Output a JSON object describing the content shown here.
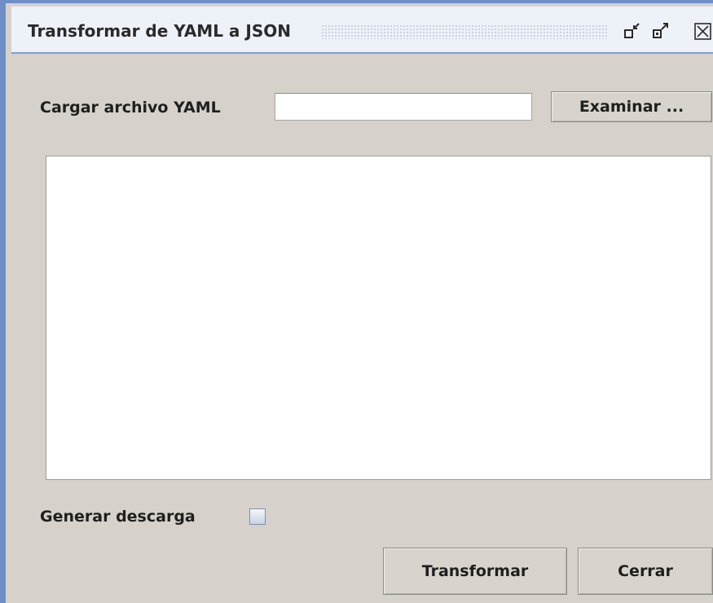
{
  "window": {
    "title": "Transformar de YAML a JSON",
    "controls": [
      "minimize-icon",
      "maximize-icon",
      "close-icon"
    ]
  },
  "file_row": {
    "label": "Cargar archivo YAML",
    "input_value": "",
    "browse_label": "Examinar ..."
  },
  "output": {
    "value": ""
  },
  "download": {
    "label": "Generar descarga",
    "checked": false
  },
  "actions": {
    "transform_label": "Transformar",
    "close_label": "Cerrar"
  },
  "colors": {
    "window_border": "#6f8ec6",
    "panel_background": "#d6d2cb",
    "titlebar_background": "#edf1f8"
  }
}
